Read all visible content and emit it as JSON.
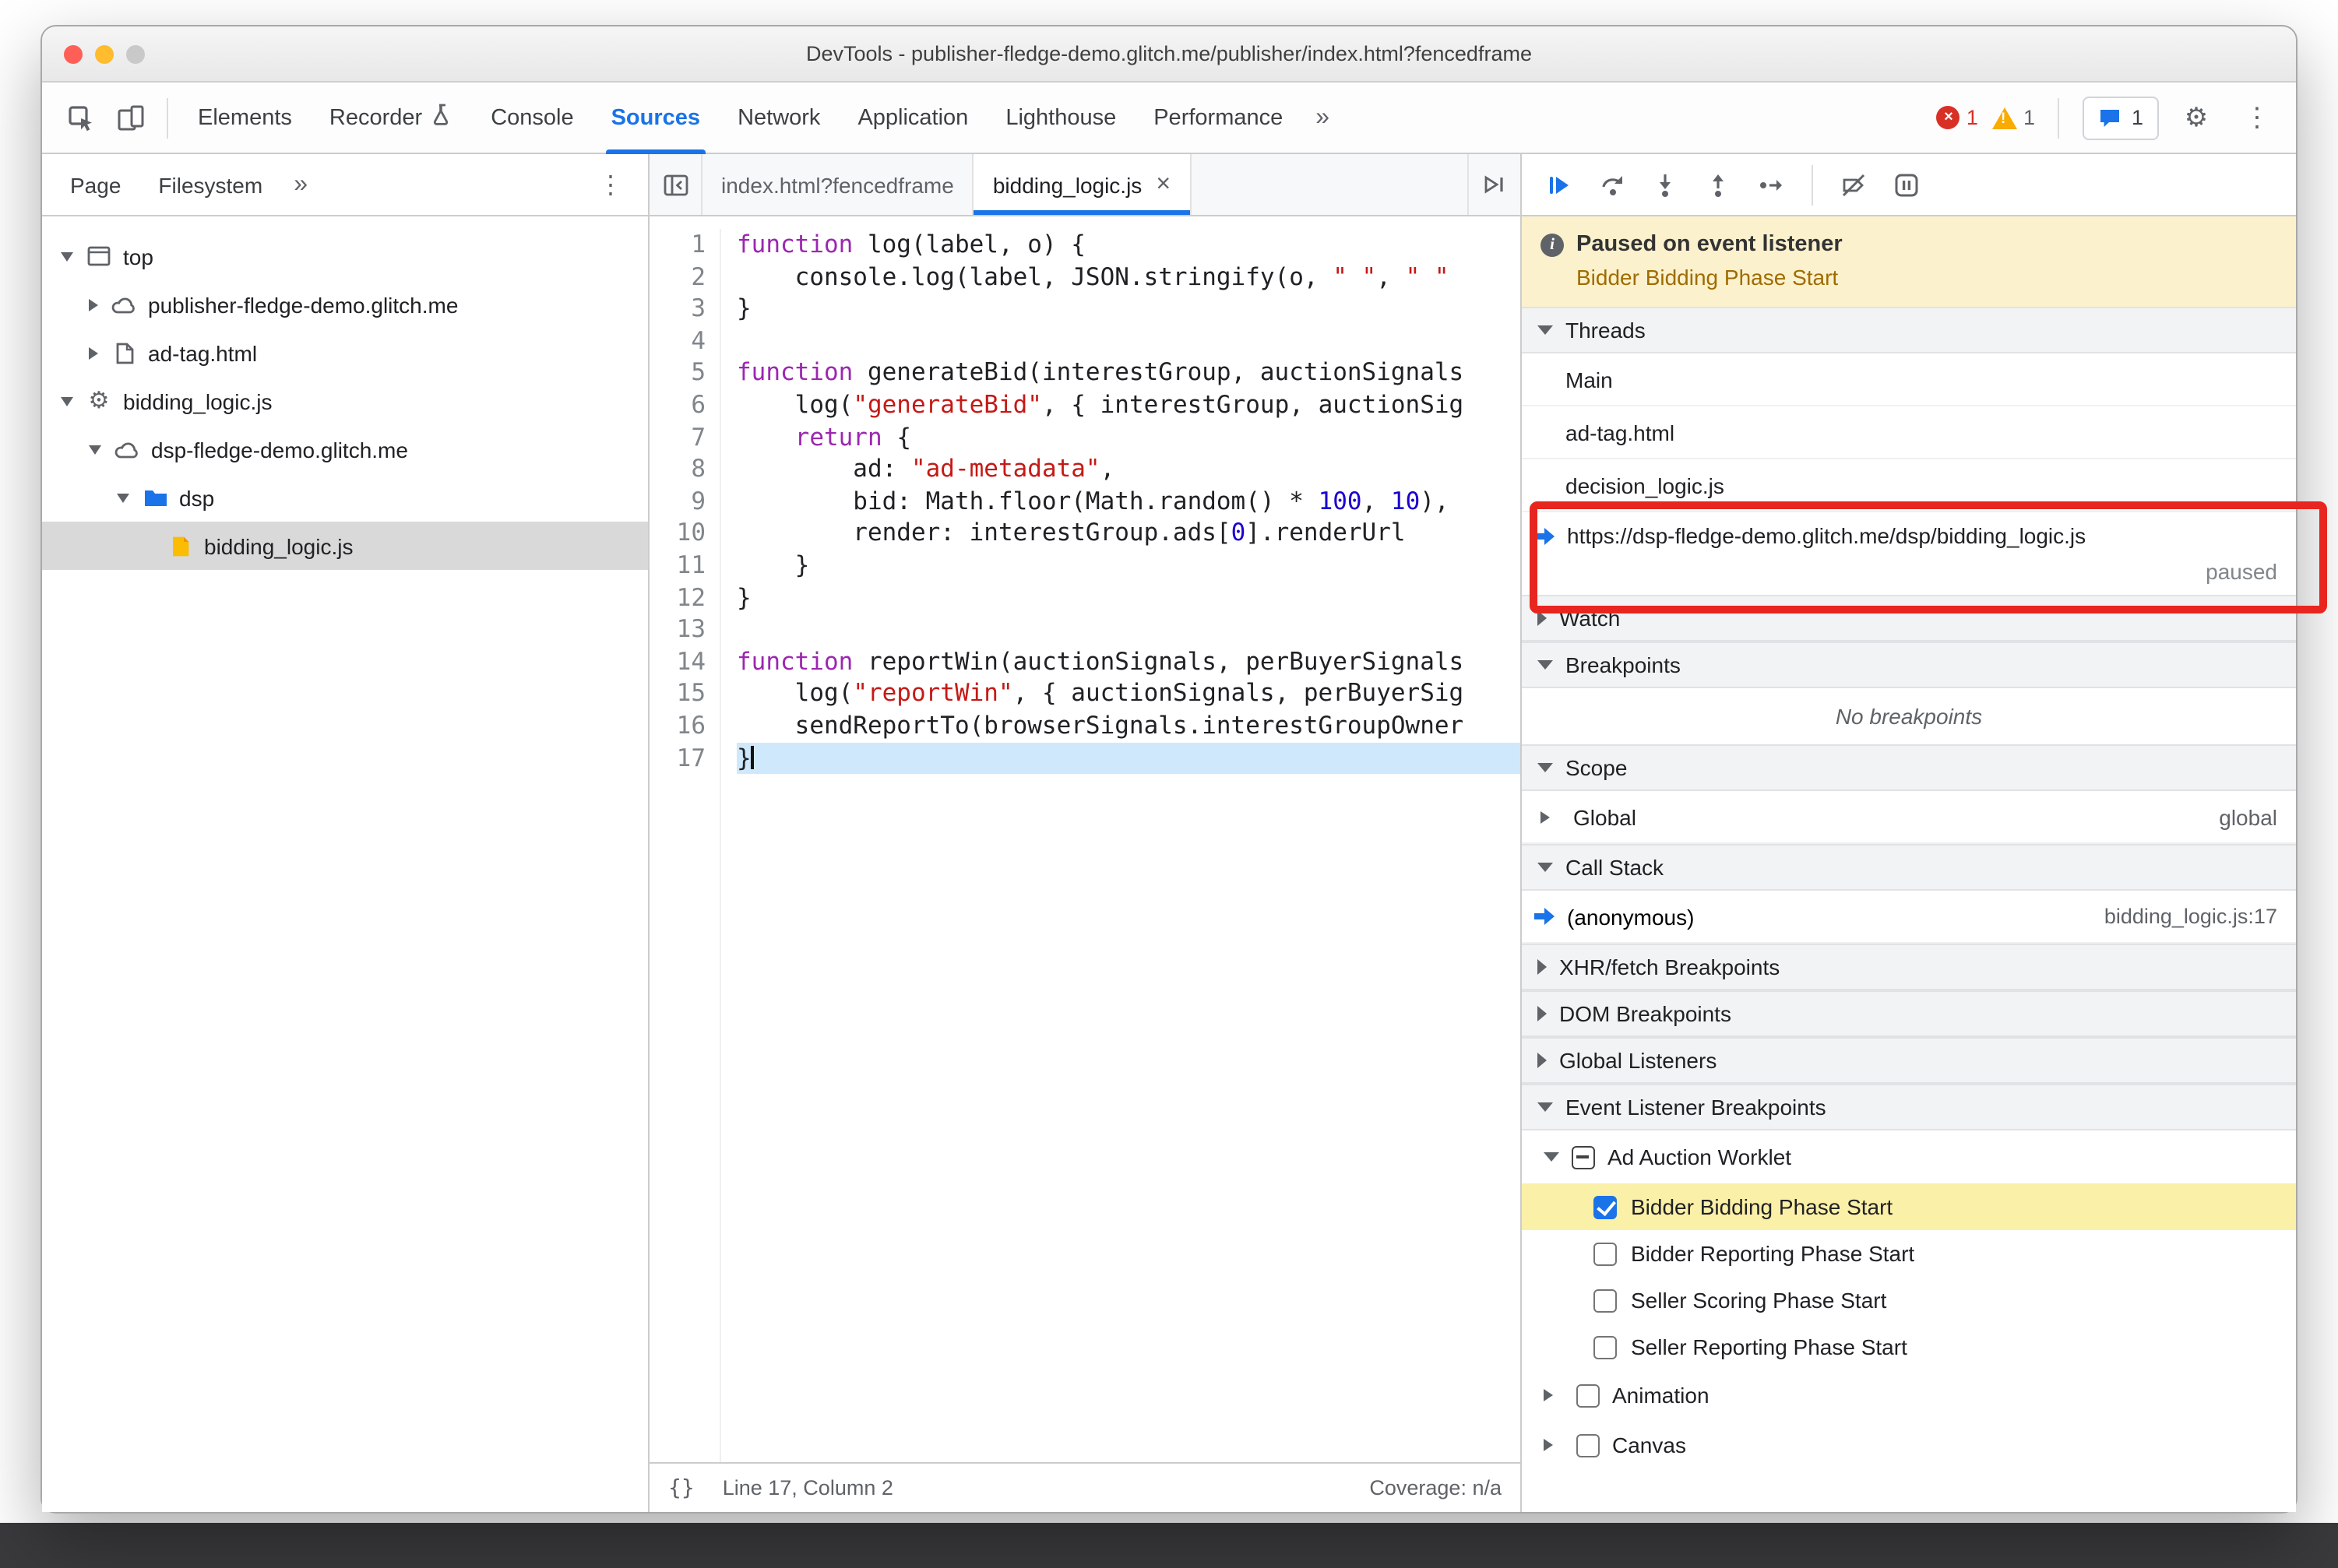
{
  "window_title": "DevTools - publisher-fledge-demo.glitch.me/publisher/index.html?fencedframe",
  "icons": {
    "gear": "⚙",
    "kebab": "⋮",
    "more": "»",
    "close": "×",
    "x": "×",
    "excl": "!",
    "info": "i",
    "braces": "{}"
  },
  "annotation": {
    "color": "#e8261f"
  },
  "toolbar": {
    "tabs": [
      {
        "label": "Elements"
      },
      {
        "label": "Recorder",
        "icon": "experiment"
      },
      {
        "label": "Console"
      },
      {
        "label": "Sources",
        "active": true
      },
      {
        "label": "Network"
      },
      {
        "label": "Application"
      },
      {
        "label": "Lighthouse"
      },
      {
        "label": "Performance"
      }
    ],
    "error_count": "1",
    "warning_count": "1",
    "issues_count": "1"
  },
  "sidebar": {
    "tabs": [
      "Page",
      "Filesystem"
    ],
    "tree": [
      {
        "label": "top",
        "icon": "frame",
        "disclosure": "down",
        "depth": 0
      },
      {
        "label": "publisher-fledge-demo.glitch.me",
        "icon": "cloud",
        "disclosure": "right",
        "depth": 1
      },
      {
        "label": "ad-tag.html",
        "icon": "document",
        "disclosure": "right",
        "depth": 1
      },
      {
        "label": "bidding_logic.js",
        "icon": "gear",
        "disclosure": "down",
        "depth": 0
      },
      {
        "label": "dsp-fledge-demo.glitch.me",
        "icon": "cloud",
        "disclosure": "down",
        "depth": 1
      },
      {
        "label": "dsp",
        "icon": "folder",
        "disclosure": "down",
        "depth": 2
      },
      {
        "label": "bidding_logic.js",
        "icon": "file",
        "disclosure": "none",
        "depth": 3,
        "selected": true
      }
    ]
  },
  "editor": {
    "tabs": [
      {
        "label": "index.html?fencedframe"
      },
      {
        "label": "bidding_logic.js",
        "active": true,
        "close": "×"
      }
    ],
    "lines": [
      {
        "n": "1",
        "seg": [
          [
            "k",
            "function"
          ],
          [
            "d",
            " log(label, o) {"
          ]
        ]
      },
      {
        "n": "2",
        "seg": [
          [
            "d",
            "    console.log(label, JSON.stringify(o, "
          ],
          [
            "s",
            "\" \""
          ],
          [
            "d",
            ", "
          ],
          [
            "s",
            "\" \""
          ]
        ]
      },
      {
        "n": "3",
        "seg": [
          [
            "d",
            "}"
          ]
        ]
      },
      {
        "n": "4",
        "seg": []
      },
      {
        "n": "5",
        "seg": [
          [
            "k",
            "function"
          ],
          [
            "d",
            " generateBid(interestGroup, auctionSignals"
          ]
        ]
      },
      {
        "n": "6",
        "seg": [
          [
            "d",
            "    log("
          ],
          [
            "s",
            "\"generateBid\""
          ],
          [
            "d",
            ", { interestGroup, auctionSig"
          ]
        ]
      },
      {
        "n": "7",
        "seg": [
          [
            "d",
            "    "
          ],
          [
            "k",
            "return"
          ],
          [
            "d",
            " {"
          ]
        ]
      },
      {
        "n": "8",
        "seg": [
          [
            "d",
            "        ad: "
          ],
          [
            "s",
            "\"ad-metadata\""
          ],
          [
            "d",
            ","
          ]
        ]
      },
      {
        "n": "9",
        "seg": [
          [
            "d",
            "        bid: Math.floor(Math.random() * "
          ],
          [
            "num",
            "100"
          ],
          [
            "d",
            ", "
          ],
          [
            "num",
            "10"
          ],
          [
            "d",
            "),"
          ]
        ]
      },
      {
        "n": "10",
        "seg": [
          [
            "d",
            "        render: interestGroup.ads["
          ],
          [
            "num",
            "0"
          ],
          [
            "d",
            "].renderUrl"
          ]
        ]
      },
      {
        "n": "11",
        "seg": [
          [
            "d",
            "    }"
          ]
        ]
      },
      {
        "n": "12",
        "seg": [
          [
            "d",
            "}"
          ]
        ]
      },
      {
        "n": "13",
        "seg": []
      },
      {
        "n": "14",
        "seg": [
          [
            "k",
            "function"
          ],
          [
            "d",
            " reportWin(auctionSignals, perBuyerSignals"
          ]
        ]
      },
      {
        "n": "15",
        "seg": [
          [
            "d",
            "    log("
          ],
          [
            "s",
            "\"reportWin\""
          ],
          [
            "d",
            ", { auctionSignals, perBuyerSig"
          ]
        ]
      },
      {
        "n": "16",
        "seg": [
          [
            "d",
            "    sendReportTo(browserSignals.interestGroupOwner"
          ]
        ]
      },
      {
        "n": "17",
        "seg": [
          [
            "d",
            "}"
          ]
        ],
        "exec": true
      }
    ],
    "status": {
      "position": "Line 17, Column 2",
      "coverage": "Coverage: n/a"
    }
  },
  "dbg": {
    "banner_title": "Paused on event listener",
    "banner_subtitle": "Bidder Bidding Phase Start",
    "threads_title": "Threads",
    "thread_1": "Main",
    "thread_2": "ad-tag.html",
    "thread_3": "decision_logic.js",
    "paused_thread_url": "https://dsp-fledge-demo.glitch.me/dsp/bidding_logic.js",
    "paused_thread_status": "paused",
    "watch_title": "Watch",
    "breakpoints_title": "Breakpoints",
    "breakpoints_empty": "No breakpoints",
    "scope_title": "Scope",
    "scope_row_label": "Global",
    "scope_row_value": "global",
    "call_stack_title": "Call Stack",
    "frame_label": "(anonymous)",
    "frame_location": "bidding_logic.js:17",
    "xhr_title": "XHR/fetch Breakpoints",
    "dom_title": "DOM Breakpoints",
    "global_listeners_title": "Global Listeners",
    "elb_title": "Event Listener Breakpoints",
    "elb_group": "Ad Auction Worklet",
    "elb_children": [
      "Bidder Bidding Phase Start",
      "Bidder Reporting Phase Start",
      "Seller Scoring Phase Start",
      "Seller Reporting Phase Start"
    ],
    "animation": "Animation",
    "canvas": "Canvas"
  }
}
